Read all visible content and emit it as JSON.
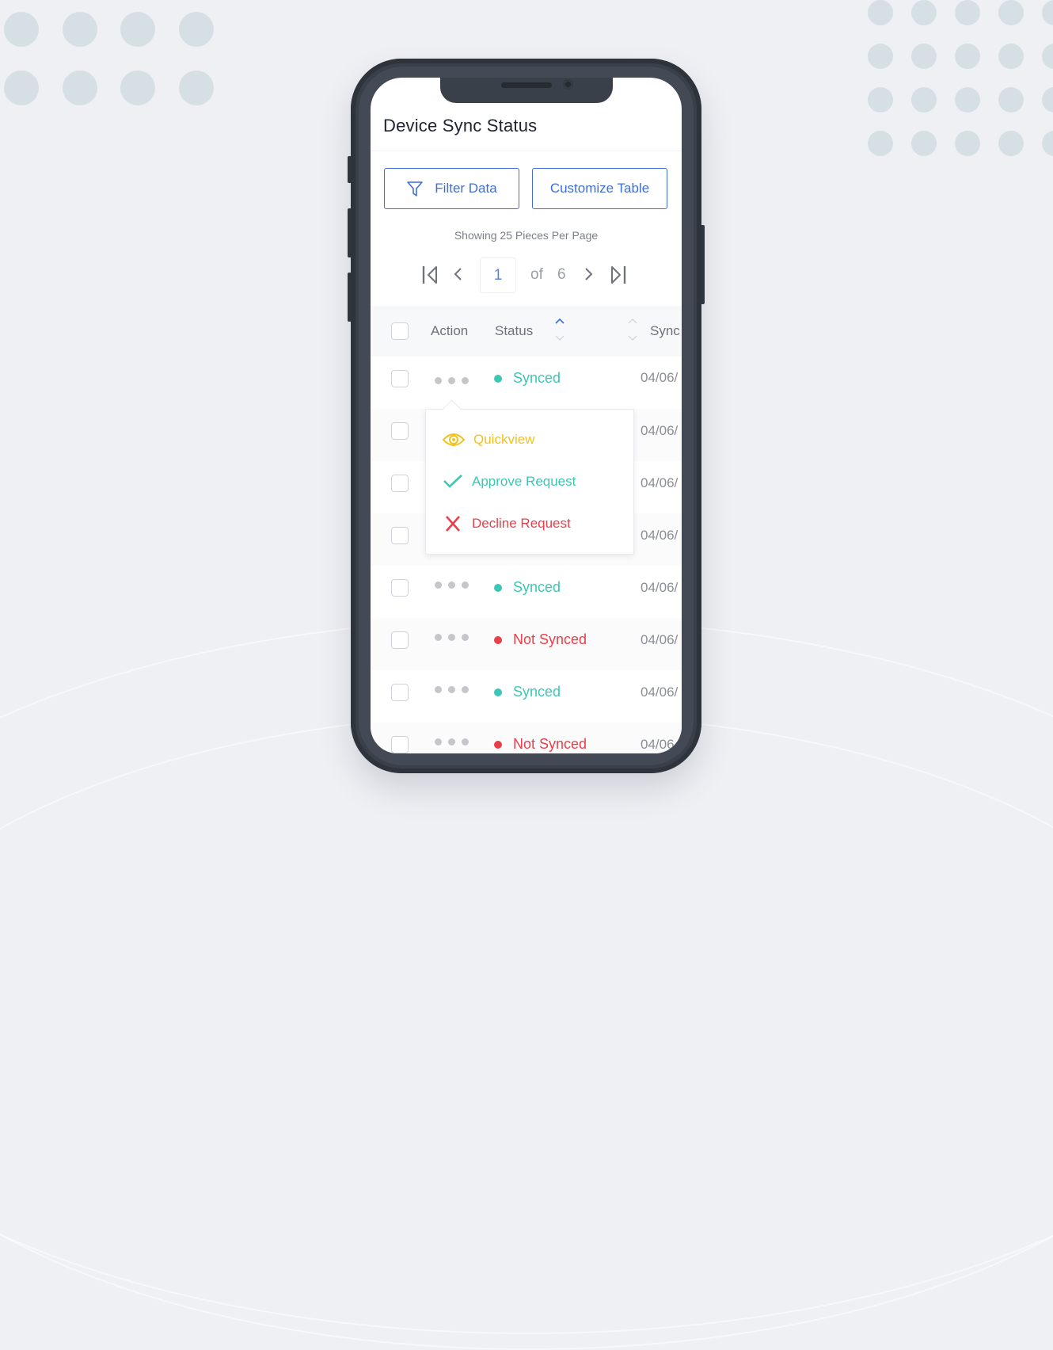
{
  "screen": {
    "title": "Device Sync Status",
    "toolbar": {
      "filter_label": "Filter Data",
      "filter_icon": "funnel-icon",
      "customize_label": "Customize Table"
    },
    "pagination": {
      "showing_text": "Showing 25 Pieces Per Page",
      "current_page": "1",
      "of_label": "of",
      "total_pages": "6",
      "icons": [
        "first-page-icon",
        "prev-page-icon",
        "next-page-icon",
        "last-page-icon"
      ]
    },
    "table": {
      "columns": [
        {
          "label": "Action"
        },
        {
          "label": "Status",
          "sort": "ascending"
        },
        {
          "label": "Sync"
        }
      ],
      "rows": [
        {
          "status": "Synced",
          "date": "04/06/"
        },
        {
          "status": "",
          "date": "04/06/"
        },
        {
          "status": "",
          "date": "04/06/"
        },
        {
          "status": "",
          "date": "04/06/"
        },
        {
          "status": "Synced",
          "date": "04/06/"
        },
        {
          "status": "Not Synced",
          "date": "04/06/"
        },
        {
          "status": "Synced",
          "date": "04/06/"
        },
        {
          "status": "Not Synced",
          "date": "04/06"
        }
      ]
    },
    "action_menu": {
      "items": [
        {
          "label": "Quickview",
          "icon": "eye-icon",
          "color": "#f2c21b"
        },
        {
          "label": "Approve Request",
          "icon": "checkmark-icon",
          "color": "#3cc7b4"
        },
        {
          "label": "Decline Request",
          "icon": "x-icon",
          "color": "#e8404a"
        }
      ]
    }
  },
  "colors": {
    "accent": "#3e6fd8",
    "synced": "#3cc7b4",
    "not_synced": "#e8404a",
    "quickview": "#f2c21b"
  }
}
